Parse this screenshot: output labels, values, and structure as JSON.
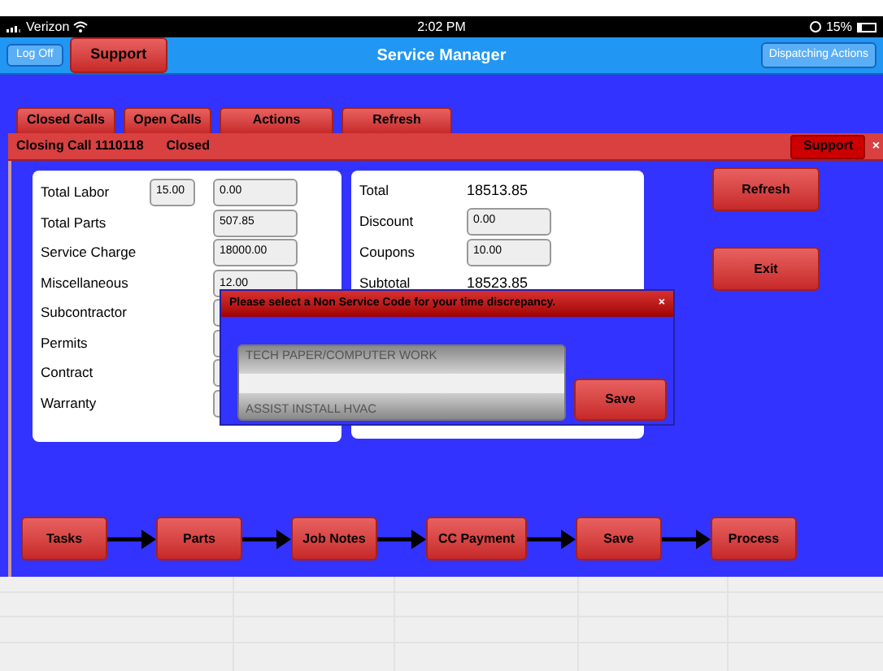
{
  "status_bar": {
    "carrier": "Verizon",
    "time": "2:02 PM",
    "battery": "15%"
  },
  "nav": {
    "back_button": "Log Off",
    "support_button": "Support",
    "title": "Service Manager",
    "right_button": "Dispatching Actions"
  },
  "tabs": [
    {
      "label": "Closed Calls",
      "selected": false
    },
    {
      "label": "Open Calls",
      "selected": false
    },
    {
      "label": "Actions",
      "selected": false
    },
    {
      "label": "Refresh",
      "selected": false
    }
  ],
  "dialog": {
    "title": "Closing Call 1110118",
    "status": "Closed",
    "support_button": "Support",
    "close": "×"
  },
  "charges": [
    {
      "label": "Total Labor",
      "hours": "15.00",
      "value": "0.00"
    },
    {
      "label": "Total Parts",
      "value": "507.85"
    },
    {
      "label": "Service Charge",
      "value": "18000.00"
    },
    {
      "label": "Miscellaneous",
      "value": "12.00"
    },
    {
      "label": "Subcontractor"
    },
    {
      "label": "Permits"
    },
    {
      "label": "Contract"
    },
    {
      "label": "Warranty"
    }
  ],
  "totals": [
    {
      "label": "Total",
      "kind": "text",
      "value": "18513.85"
    },
    {
      "label": "Discount",
      "kind": "field",
      "value": "0.00"
    },
    {
      "label": "Coupons",
      "kind": "field",
      "value": "10.00"
    },
    {
      "label": "Subtotal",
      "kind": "text",
      "value": "18523.85"
    }
  ],
  "side_buttons": [
    "Refresh",
    "Exit"
  ],
  "popup": {
    "title": "Please select a Non Service Code for your time discrepancy.",
    "close": "×",
    "options": [
      "TECH PAPER/COMPUTER WORK",
      "ASSIST INSTALL HVAC"
    ],
    "save_button": "Save"
  },
  "workflow": [
    "Tasks",
    "Parts",
    "Job Notes",
    "CC Payment",
    "Save",
    "Process"
  ]
}
